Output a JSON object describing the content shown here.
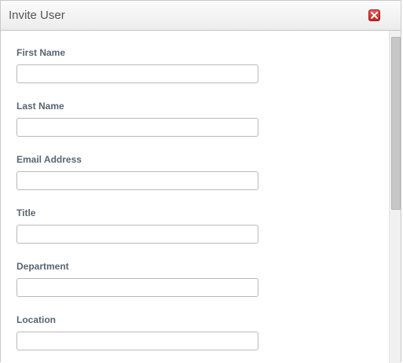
{
  "dialog": {
    "title": "Invite User",
    "close_icon": "close-icon",
    "close_color": "#d32a2a"
  },
  "form": {
    "fields": [
      {
        "label": "First Name",
        "value": "",
        "placeholder": ""
      },
      {
        "label": "Last Name",
        "value": "",
        "placeholder": ""
      },
      {
        "label": "Email Address",
        "value": "",
        "placeholder": ""
      },
      {
        "label": "Title",
        "value": "",
        "placeholder": ""
      },
      {
        "label": "Department",
        "value": "",
        "placeholder": ""
      },
      {
        "label": "Location",
        "value": "",
        "placeholder": ""
      }
    ]
  }
}
